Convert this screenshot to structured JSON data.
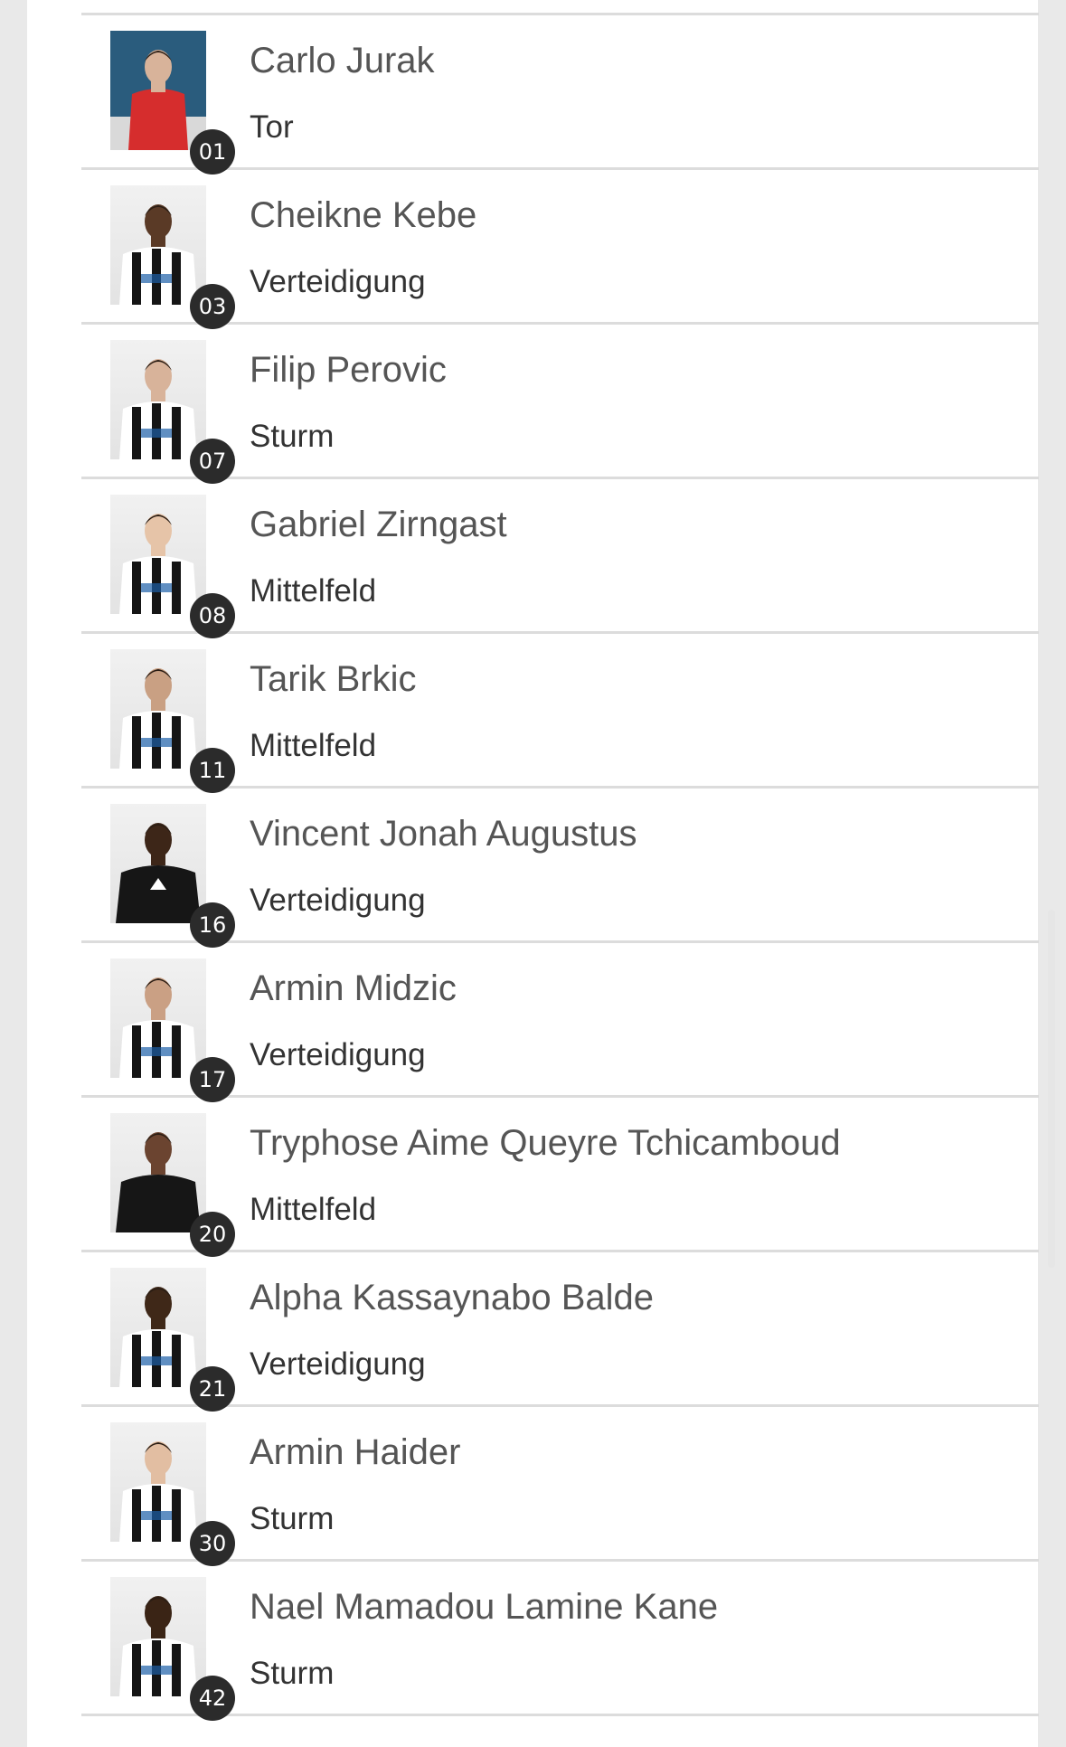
{
  "players": [
    {
      "name": "Carlo Jurak",
      "position": "Tor",
      "number": "01",
      "photo_alt": "player-photo",
      "kit": "red"
    },
    {
      "name": "Cheikne Kebe",
      "position": "Verteidigung",
      "number": "03",
      "kit": "stripes",
      "skin": "#5a3a26"
    },
    {
      "name": "Filip Perovic",
      "position": "Sturm",
      "number": "07",
      "kit": "stripes",
      "skin": "#d8b39a"
    },
    {
      "name": "Gabriel Zirngast",
      "position": "Mittelfeld",
      "number": "08",
      "kit": "stripes-light",
      "skin": "#e6c4a8"
    },
    {
      "name": "Tarik Brkic",
      "position": "Mittelfeld",
      "number": "11",
      "kit": "stripes",
      "skin": "#c9a083"
    },
    {
      "name": "Vincent Jonah Augustus",
      "position": "Verteidigung",
      "number": "16",
      "kit": "black",
      "skin": "#3d2618"
    },
    {
      "name": "Armin Midzic",
      "position": "Verteidigung",
      "number": "17",
      "kit": "stripes",
      "skin": "#caa084"
    },
    {
      "name": "Tryphose Aime Queyre Tchicamboud",
      "position": "Mittelfeld",
      "number": "20",
      "kit": "black-plain",
      "skin": "#6b4430"
    },
    {
      "name": "Alpha Kassaynabo Balde",
      "position": "Verteidigung",
      "number": "21",
      "kit": "stripes",
      "skin": "#3f2818"
    },
    {
      "name": "Armin Haider",
      "position": "Sturm",
      "number": "30",
      "kit": "stripes-light",
      "skin": "#e2bea2"
    },
    {
      "name": "Nael Mamadou Lamine Kane",
      "position": "Sturm",
      "number": "42",
      "kit": "stripes",
      "skin": "#3a2415"
    }
  ]
}
